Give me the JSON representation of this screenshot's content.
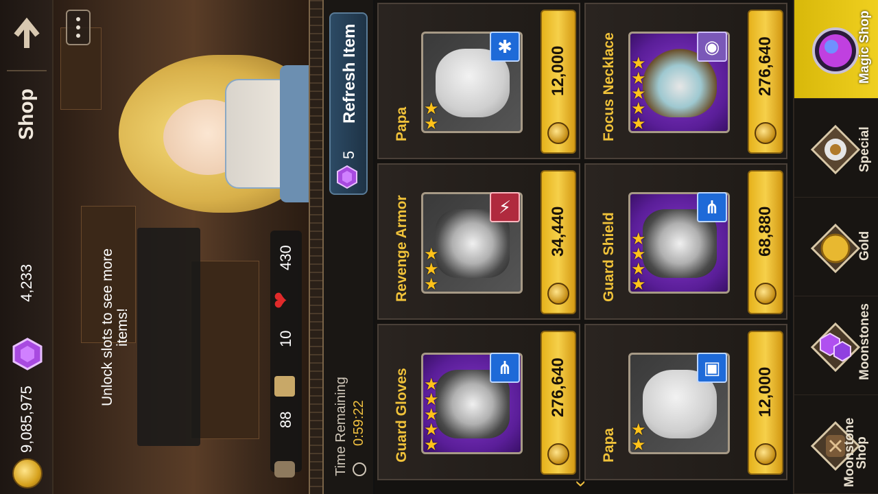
{
  "header": {
    "title": "Shop",
    "gold": "9,085,975",
    "gems": "4,233"
  },
  "scene": {
    "unlock_message": "Unlock slots to see more items!",
    "stat_a": "88",
    "stat_b": "10",
    "stat_c": "430"
  },
  "info": {
    "refresh_label": "Refresh Item",
    "refresh_cost": "5",
    "time_label": "Time Remaining",
    "time_value": "0:59:22"
  },
  "items": [
    {
      "name": "Papa",
      "price": "12,000",
      "stars": 2,
      "element": "water",
      "element_glyph": "✱"
    },
    {
      "name": "Revenge Armor",
      "price": "34,440",
      "stars": 3,
      "element": "fire",
      "element_glyph": "⚡"
    },
    {
      "name": "Guard Gloves",
      "price": "276,640",
      "stars": 5,
      "element": "blue",
      "element_glyph": "⋔"
    },
    {
      "name": "Focus Necklace",
      "price": "276,640",
      "stars": 5,
      "element": "dark",
      "element_glyph": "◉"
    },
    {
      "name": "Guard Shield",
      "price": "68,880",
      "stars": 4,
      "element": "blue",
      "element_glyph": "⋔"
    },
    {
      "name": "Papa",
      "price": "12,000",
      "stars": 2,
      "element": "blue",
      "element_glyph": "▣"
    }
  ],
  "nav": [
    {
      "label": "Magic Shop",
      "icon": "magic-orb-icon",
      "active": true
    },
    {
      "label": "Special",
      "icon": "special-emblem-icon",
      "active": false
    },
    {
      "label": "Gold",
      "icon": "gold-coin-icon",
      "active": false
    },
    {
      "label": "Moonstones",
      "icon": "moonstone-icon",
      "active": false
    },
    {
      "label": "Moonstone Shop",
      "icon": "moonstone-shop-icon",
      "active": false
    }
  ],
  "colors": {
    "accent_gold": "#f0c23a",
    "price_button": "#f6d04a",
    "nav_active": "#f0d020",
    "refresh_button": "#2c4a64"
  }
}
